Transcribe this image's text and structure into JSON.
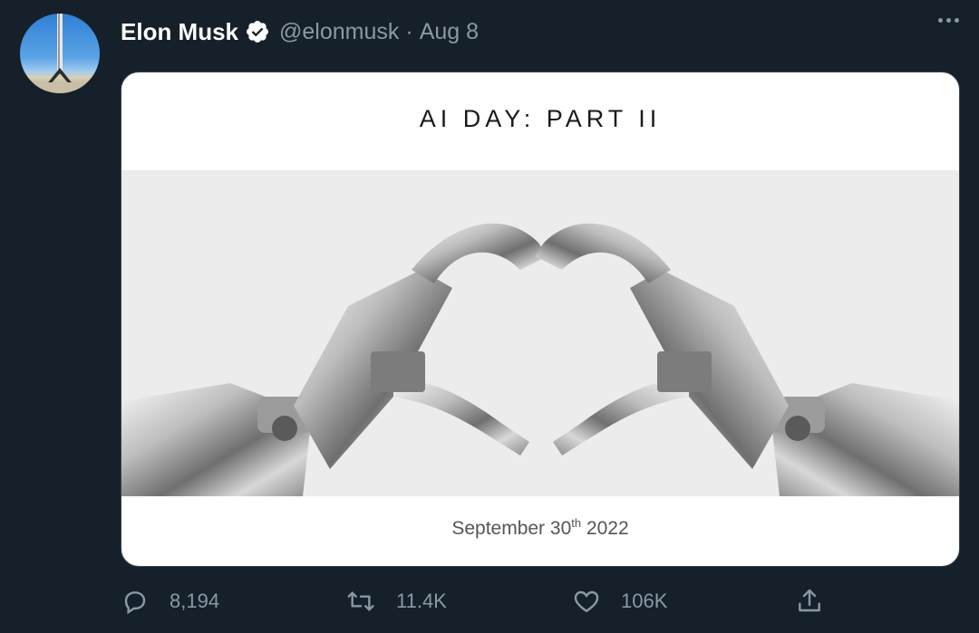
{
  "tweet": {
    "author_name": "Elon Musk",
    "handle": "@elonmusk",
    "separator": "·",
    "date": "Aug 8"
  },
  "card": {
    "title": "AI DAY: PART II",
    "date_prefix": "September 30",
    "date_suffix": "th",
    "date_year": " 2022"
  },
  "actions": {
    "replies": "8,194",
    "retweets": "11.4K",
    "likes": "106K"
  },
  "icons": {
    "verified": "verified-badge-icon",
    "more": "more-options-icon",
    "reply": "reply-icon",
    "retweet": "retweet-icon",
    "like": "heart-icon",
    "share": "share-icon"
  },
  "colors": {
    "background": "#15202b",
    "secondary_text": "#8b98a5",
    "border": "#38444d"
  }
}
